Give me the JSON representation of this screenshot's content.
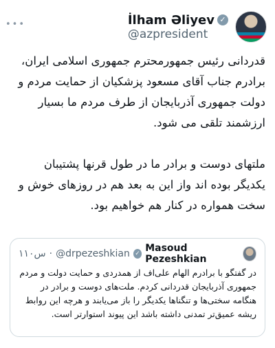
{
  "tweet": {
    "author": {
      "name": "İlham Əliyev",
      "handle": "@azpresident"
    },
    "paragraphs": [
      "قدردانی رئیس جمهورمحترم جمهوری اسلامی ایران، برادرم جناب آقای مسعود پزشکیان از حمایت مردم و دولت جمهوری آذربایجان از طرف مردم ما بسیار ارزشمند تلقی می شود.",
      "ملتهای دوست و برادر ما در طول قرنها پشتیبان یکدیگر بوده اند واز این به بعد هم در روزهای خوش و سخت همواره در کنار هم خواهیم بود."
    ],
    "more_icon": "more-horizontal-icon",
    "verified_icon": "verified-badge-icon"
  },
  "quote": {
    "author": {
      "name": "Masoud Pezeshkian",
      "handle": "@drpezeshkian"
    },
    "separator": "·",
    "time": "۱۱۰س",
    "text": "در گفتگو با برادرم الهام علی‌اف از همدردی و حمایت دولت و مردم جمهوری آذربایجان قدردانی کردم. ملت‌های دوست و برادر در هنگامه سختی‌ها و تنگناها یکدیگر را باز می‌یابند و هرچه این روابط ریشه عمیق‌تر تمدنی داشته باشد این پیوند استوارتر است."
  },
  "colors": {
    "text": "#0f1419",
    "secondary": "#536471",
    "border": "#cfd9de",
    "badge": "#829aab"
  }
}
